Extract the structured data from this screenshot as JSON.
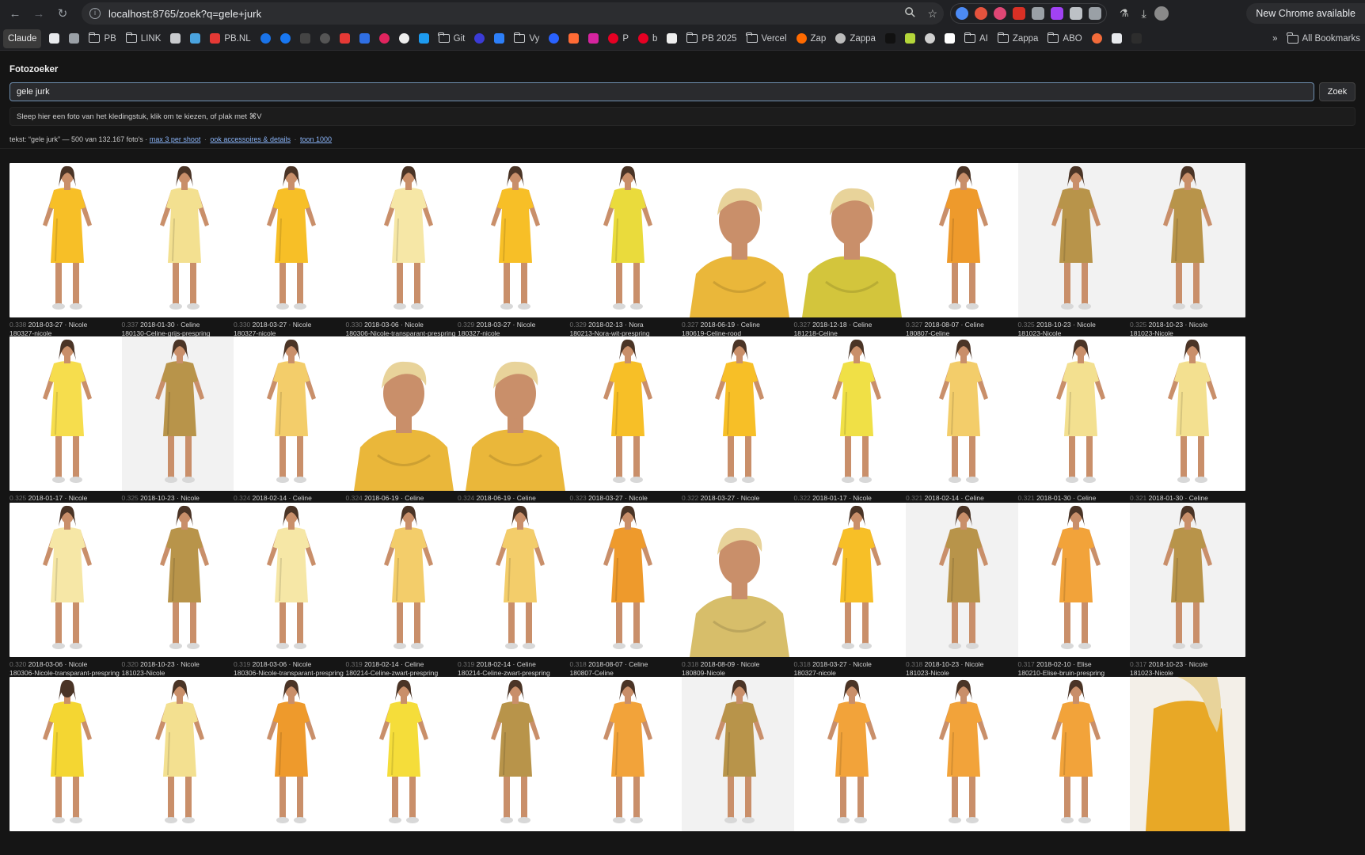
{
  "browser": {
    "url": "localhost:8765/zoek?q=gele+jurk",
    "new_chrome_label": "New Chrome available",
    "extension_colors": [
      "#4c8bf5",
      "#e5533d",
      "#e04775",
      "#d93025",
      "#9aa0a6",
      "#a142f4",
      "#bdc1c6",
      "#9aa0a6"
    ]
  },
  "bookmarks": [
    {
      "label": "Claude",
      "kind": "claude"
    },
    {
      "label": "",
      "kind": "fav",
      "color": "#e8eaed"
    },
    {
      "label": "",
      "kind": "fav",
      "color": "#9aa0a6"
    },
    {
      "label": "PB",
      "kind": "folder"
    },
    {
      "label": "LINK",
      "kind": "folder"
    },
    {
      "label": "",
      "kind": "fav",
      "color": "#c9cbce"
    },
    {
      "label": "",
      "kind": "fav",
      "color": "#4aa3df"
    },
    {
      "label": "PB.NL",
      "kind": "fav",
      "color": "#e53935"
    },
    {
      "label": "",
      "kind": "fav",
      "color": "#1a73e8",
      "circle": true
    },
    {
      "label": "",
      "kind": "fav",
      "color": "#1877f2",
      "circle": true
    },
    {
      "label": "",
      "kind": "fav",
      "color": "#444444"
    },
    {
      "label": "",
      "kind": "fav",
      "color": "#555555",
      "circle": true
    },
    {
      "label": "",
      "kind": "fav",
      "color": "#e53935"
    },
    {
      "label": "",
      "kind": "fav",
      "color": "#2f6fe4"
    },
    {
      "label": "",
      "kind": "fav",
      "color": "#e0245e",
      "circle": true
    },
    {
      "label": "",
      "kind": "fav",
      "color": "#eeeeee",
      "circle": true
    },
    {
      "label": "",
      "kind": "fav",
      "color": "#1d9bf0"
    },
    {
      "label": "Git",
      "kind": "folder"
    },
    {
      "label": "",
      "kind": "fav",
      "color": "#3b3bd6",
      "circle": true
    },
    {
      "label": "",
      "kind": "fav",
      "color": "#2d7ff9"
    },
    {
      "label": "Vy",
      "kind": "folder"
    },
    {
      "label": "",
      "kind": "fav",
      "color": "#2962ff",
      "circle": true
    },
    {
      "label": "",
      "kind": "fav",
      "color": "#ff6b35"
    },
    {
      "label": "",
      "kind": "fav",
      "color": "#d6249f"
    },
    {
      "label": "P",
      "kind": "fav",
      "color": "#e60023",
      "circle": true
    },
    {
      "label": "b",
      "kind": "fav",
      "color": "#e60023",
      "circle": true
    },
    {
      "label": "",
      "kind": "fav",
      "color": "#eeeeee"
    },
    {
      "label": "PB 2025",
      "kind": "folder"
    },
    {
      "label": "Vercel",
      "kind": "folder"
    },
    {
      "label": "Zap",
      "kind": "fav",
      "color": "#ff6a00",
      "circle": true
    },
    {
      "label": "Zappa",
      "kind": "fav",
      "color": "#bbbbbb",
      "circle": true
    },
    {
      "label": "",
      "kind": "fav",
      "color": "#111111"
    },
    {
      "label": "",
      "kind": "fav",
      "color": "#b4d63a"
    },
    {
      "label": "",
      "kind": "fav",
      "color": "#cfcfcf",
      "circle": true
    },
    {
      "label": "",
      "kind": "fav",
      "color": "#ffffff"
    },
    {
      "label": "AI",
      "kind": "folder"
    },
    {
      "label": "Zappa",
      "kind": "folder"
    },
    {
      "label": "ABO",
      "kind": "folder"
    },
    {
      "label": "",
      "kind": "fav",
      "color": "#f26b3a",
      "circle": true
    },
    {
      "label": "",
      "kind": "fav",
      "color": "#e8eaed"
    },
    {
      "label": "",
      "kind": "fav",
      "color": "#2d2d2d"
    }
  ],
  "bookmarks_overflow": "»",
  "bookmarks_all": "All Bookmarks",
  "app": {
    "title": "Fotozoeker",
    "search_value": "gele jurk",
    "search_button": "Zoek",
    "dropzone_text": "Sleep hier een foto van het kledingstuk, klik om te kiezen, of plak met ⌘V",
    "result_prefix": "tekst: “gele jurk” — 500 van 132.167 foto's ·",
    "link_max3": "max 3 per shoot",
    "link_accessoires": "ook accessoires & details",
    "link_toon1000": "toon 1000",
    "sep": "·"
  },
  "results": [
    {
      "score": "0.338",
      "date": "2018-03-27",
      "model": "Nicole",
      "shoot": "180327-nicole",
      "color": "#f7bf27",
      "pose": "dress"
    },
    {
      "score": "0.337",
      "date": "2018-01-30",
      "model": "Celine",
      "shoot": "180130-Celine-grijs-prespring",
      "color": "#f3e090",
      "pose": "dress-side"
    },
    {
      "score": "0.330",
      "date": "2018-03-27",
      "model": "Nicole",
      "shoot": "180327-nicole",
      "color": "#f7bf27",
      "pose": "dress"
    },
    {
      "score": "0.330",
      "date": "2018-03-06",
      "model": "Nicole",
      "shoot": "180306-Nicole-transparant-prespring",
      "color": "#f6e7a6",
      "pose": "dress-side"
    },
    {
      "score": "0.329",
      "date": "2018-03-27",
      "model": "Nicole",
      "shoot": "180327-nicole",
      "color": "#f7bf27",
      "pose": "dress"
    },
    {
      "score": "0.329",
      "date": "2018-02-13",
      "model": "Nora",
      "shoot": "180213-Nora-wit-prespring",
      "color": "#eadb3c",
      "pose": "dress"
    },
    {
      "score": "0.327",
      "date": "2018-06-19",
      "model": "Celine",
      "shoot": "180619-Celine-rood",
      "color": "#eab73a",
      "pose": "portrait"
    },
    {
      "score": "0.327",
      "date": "2018-12-18",
      "model": "Celine",
      "shoot": "181218-Celine",
      "color": "#d3c53c",
      "pose": "portrait"
    },
    {
      "score": "0.327",
      "date": "2018-08-07",
      "model": "Celine",
      "shoot": "180807-Celine",
      "color": "#ee9a2c",
      "pose": "dress"
    },
    {
      "score": "0.325",
      "date": "2018-10-23",
      "model": "Nicole",
      "shoot": "181023-Nicole",
      "color": "#b8944a",
      "pose": "dress",
      "grey": true
    },
    {
      "score": "0.325",
      "date": "2018-10-23",
      "model": "Nicole",
      "shoot": "181023-Nicole",
      "color": "#b8944a",
      "pose": "dress",
      "grey": true
    },
    {
      "score": "0.325",
      "date": "2018-01-17",
      "model": "Nicole",
      "shoot": "180117-Nicole-zwart-prespring",
      "color": "#f6dd4d",
      "pose": "dress"
    },
    {
      "score": "0.325",
      "date": "2018-10-23",
      "model": "Nicole",
      "shoot": "181023-Nicole",
      "color": "#b8944a",
      "pose": "dress",
      "grey": true
    },
    {
      "score": "0.324",
      "date": "2018-02-14",
      "model": "Celine",
      "shoot": "180214-Celine-zwart-prespring",
      "color": "#f3cd6a",
      "pose": "dress"
    },
    {
      "score": "0.324",
      "date": "2018-06-19",
      "model": "Celine",
      "shoot": "180619-Celine-rood",
      "color": "#eab73a",
      "pose": "portrait"
    },
    {
      "score": "0.324",
      "date": "2018-06-19",
      "model": "Celine",
      "shoot": "180619-Celine-rood",
      "color": "#eab73a",
      "pose": "portrait"
    },
    {
      "score": "0.323",
      "date": "2018-03-27",
      "model": "Nicole",
      "shoot": "180327-nicole",
      "color": "#f7bf27",
      "pose": "dress"
    },
    {
      "score": "0.322",
      "date": "2018-03-27",
      "model": "Nicole",
      "shoot": "180327-nicole",
      "color": "#f7bf27",
      "pose": "dress"
    },
    {
      "score": "0.322",
      "date": "2018-01-17",
      "model": "Nicole",
      "shoot": "180117-Nicole-zwart-prespring",
      "color": "#f0e046",
      "pose": "dress-side"
    },
    {
      "score": "0.321",
      "date": "2018-02-14",
      "model": "Celine",
      "shoot": "180214-Celine-zwart-prespring",
      "color": "#f3cd6a",
      "pose": "dress"
    },
    {
      "score": "0.321",
      "date": "2018-01-30",
      "model": "Celine",
      "shoot": "180130-Celine-grijs-prespring",
      "color": "#f3e090",
      "pose": "dress-side"
    },
    {
      "score": "0.321",
      "date": "2018-01-30",
      "model": "Celine",
      "shoot": "180130-Celine-grijs-prespring",
      "color": "#f3e090",
      "pose": "dress-side"
    },
    {
      "score": "0.320",
      "date": "2018-03-06",
      "model": "Nicole",
      "shoot": "180306-Nicole-transparant-prespring",
      "color": "#f6e7a6",
      "pose": "dress"
    },
    {
      "score": "0.320",
      "date": "2018-10-23",
      "model": "Nicole",
      "shoot": "181023-Nicole",
      "color": "#b8944a",
      "pose": "dress-side"
    },
    {
      "score": "0.319",
      "date": "2018-03-06",
      "model": "Nicole",
      "shoot": "180306-Nicole-transparant-prespring",
      "color": "#f6e7a6",
      "pose": "dress"
    },
    {
      "score": "0.319",
      "date": "2018-02-14",
      "model": "Celine",
      "shoot": "180214-Celine-zwart-prespring",
      "color": "#f3cd6a",
      "pose": "dress-side"
    },
    {
      "score": "0.319",
      "date": "2018-02-14",
      "model": "Celine",
      "shoot": "180214-Celine-zwart-prespring",
      "color": "#f3cd6a",
      "pose": "dress-side"
    },
    {
      "score": "0.318",
      "date": "2018-08-07",
      "model": "Celine",
      "shoot": "180807-Celine",
      "color": "#ee9a2c",
      "pose": "dress"
    },
    {
      "score": "0.318",
      "date": "2018-08-09",
      "model": "Nicole",
      "shoot": "180809-Nicole",
      "color": "#d7be6a",
      "pose": "portrait"
    },
    {
      "score": "0.318",
      "date": "2018-03-27",
      "model": "Nicole",
      "shoot": "180327-nicole",
      "color": "#f7bf27",
      "pose": "dress-side"
    },
    {
      "score": "0.318",
      "date": "2018-10-23",
      "model": "Nicole",
      "shoot": "181023-Nicole",
      "color": "#b8944a",
      "pose": "dress",
      "grey": true
    },
    {
      "score": "0.317",
      "date": "2018-02-10",
      "model": "Elise",
      "shoot": "180210-Elise-bruin-prespring",
      "color": "#f2a33a",
      "pose": "dress"
    },
    {
      "score": "0.317",
      "date": "2018-10-23",
      "model": "Nicole",
      "shoot": "181023-Nicole",
      "color": "#b8944a",
      "pose": "dress",
      "grey": true
    },
    {
      "color": "#f4d632",
      "pose": "dress-back"
    },
    {
      "color": "#f3e090",
      "pose": "dress"
    },
    {
      "color": "#ee9a2c",
      "pose": "dress"
    },
    {
      "color": "#f5dd3a",
      "pose": "dress"
    },
    {
      "color": "#b8944a",
      "pose": "dress"
    },
    {
      "color": "#f2a33a",
      "pose": "dress"
    },
    {
      "color": "#b8944a",
      "pose": "dress",
      "grey": true
    },
    {
      "color": "#f2a33a",
      "pose": "dress"
    },
    {
      "color": "#f2a33a",
      "pose": "dress"
    },
    {
      "color": "#f2a33a",
      "pose": "dress"
    },
    {
      "color": "#e8a826",
      "pose": "closeup"
    }
  ]
}
